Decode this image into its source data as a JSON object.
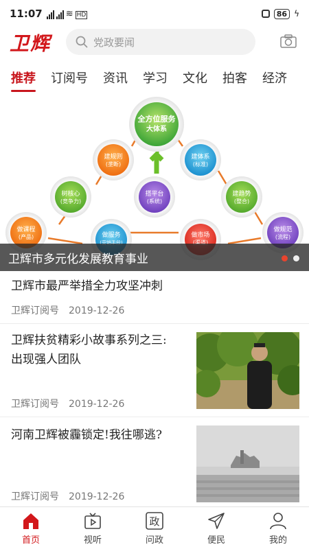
{
  "status_bar": {
    "time": "11:07",
    "signal_label": "4G",
    "hd_label": "HD",
    "battery": "86"
  },
  "header": {
    "logo": "卫辉",
    "search_placeholder": "党政要闻"
  },
  "tabs": [
    "推荐",
    "订阅号",
    "资讯",
    "学习",
    "文化",
    "拍客",
    "经济"
  ],
  "banner": {
    "caption": "卫辉市多元化发展教育事业",
    "diagram": {
      "top": {
        "line1": "全方位服务",
        "line2": "大体系"
      },
      "nodes": [
        {
          "line1": "建规则",
          "line2": "(垄断)"
        },
        {
          "line1": "建体系",
          "line2": "(标准)"
        },
        {
          "line1": "树核心",
          "line2": "(竞争力)"
        },
        {
          "line1": "搭平台",
          "line2": "(系统)"
        },
        {
          "line1": "建趋势",
          "line2": "(整合)"
        },
        {
          "line1": "做课程",
          "line2": "(产品)"
        },
        {
          "line1": "做服务",
          "line2": "(营销手段)"
        },
        {
          "line1": "做市场",
          "line2": "(渠道)"
        },
        {
          "line1": "做规范",
          "line2": "(流程)"
        }
      ]
    },
    "slide_count": 2,
    "active_slide": 1
  },
  "news": [
    {
      "title": "卫辉市最严举措全力攻坚冲刺",
      "title2": "",
      "source": "卫辉订阅号",
      "date": "2019-12-26"
    },
    {
      "title": "卫辉扶贫精彩小故事系列之三:",
      "title2": "出现强人团队",
      "source": "卫辉订阅号",
      "date": "2019-12-26"
    },
    {
      "title": "河南卫辉被霾锁定!我往哪逃?",
      "title2": "",
      "source": "卫辉订阅号",
      "date": "2019-12-26"
    }
  ],
  "bottom_nav": [
    {
      "label": "首页",
      "icon": "home-icon"
    },
    {
      "label": "视听",
      "icon": "tv-icon"
    },
    {
      "label": "问政",
      "icon": "zheng-icon",
      "glyph": "政"
    },
    {
      "label": "便民",
      "icon": "send-icon"
    },
    {
      "label": "我的",
      "icon": "user-icon"
    }
  ],
  "colors": {
    "brand": "#d2171b",
    "tab_active": "#c8161d",
    "dot_active": "#e8442e"
  }
}
